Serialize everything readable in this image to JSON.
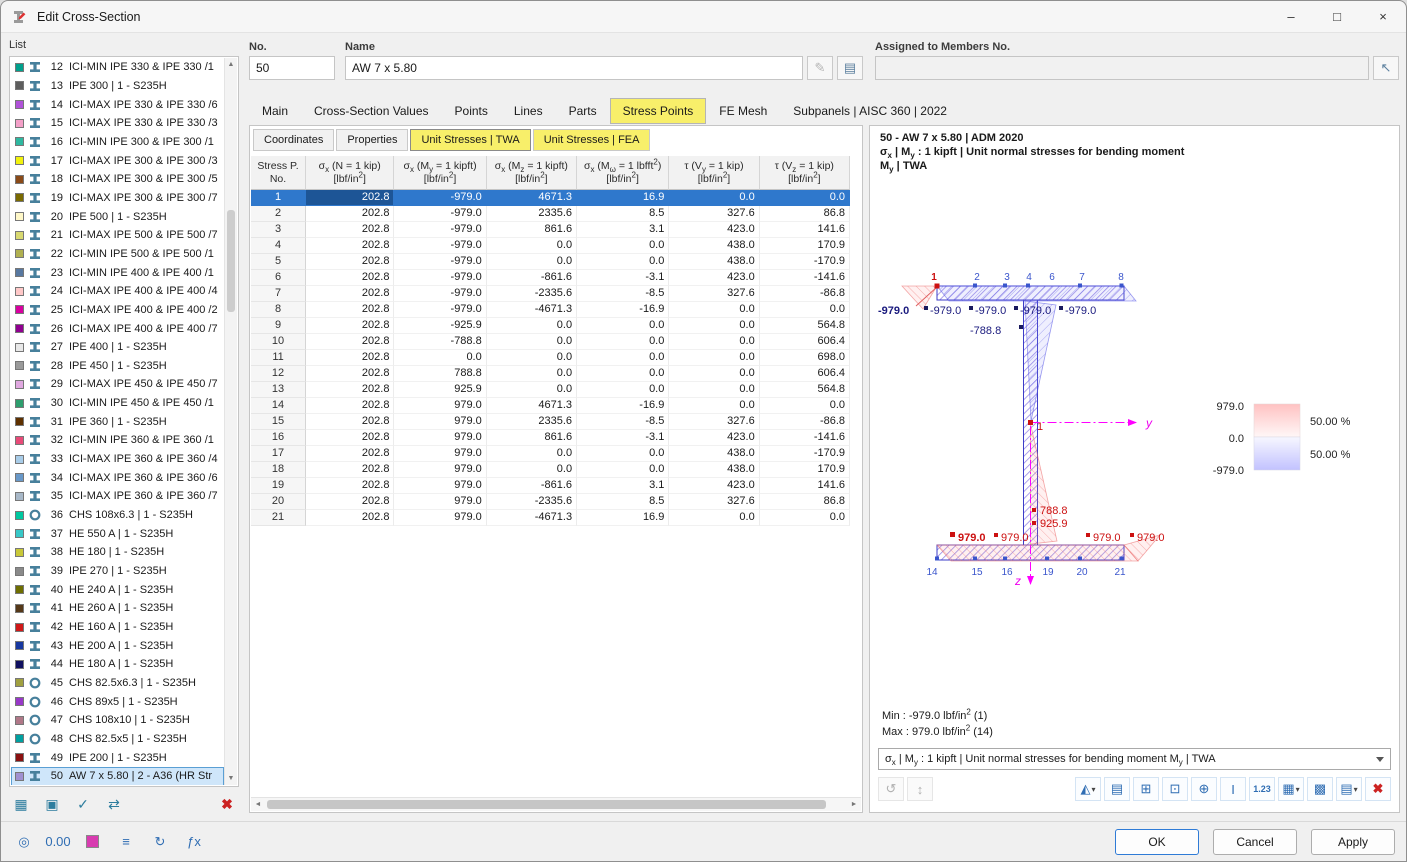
{
  "window": {
    "title": "Edit Cross-Section",
    "controls": {
      "minimize": "–",
      "maximize": "□",
      "close": "×"
    }
  },
  "colors": {
    "accent_blue": "#2f78cc",
    "highlight_yellow": "#f8ef6a",
    "list_selection": "#cfe6fa",
    "axis_magenta": "#ff00ff",
    "negative_navy": "#1a1a7e",
    "positive_red": "#cc1111",
    "swatch_magenta": "#d83cb0"
  },
  "left_panel": {
    "title": "List",
    "selected_no": "50",
    "items": [
      {
        "no": "12",
        "label": "ICI-MIN IPE 330 & IPE 330 /1",
        "color": "#00A08C",
        "icon": "ibeam"
      },
      {
        "no": "13",
        "label": "IPE 300 | 1 - S235H",
        "color": "#5E5E5E",
        "icon": "ibeam"
      },
      {
        "no": "14",
        "label": "ICI-MAX IPE 330 & IPE 330 /6",
        "color": "#B052D8",
        "icon": "ibeam"
      },
      {
        "no": "15",
        "label": "ICI-MAX IPE 330 & IPE 330 /3",
        "color": "#F4A0C8",
        "icon": "ibeam"
      },
      {
        "no": "16",
        "label": "ICI-MIN IPE 300 & IPE 300 /1",
        "color": "#2EB8A0",
        "icon": "ibeam"
      },
      {
        "no": "17",
        "label": "ICI-MAX IPE 300 & IPE 300 /3",
        "color": "#F2F20C",
        "icon": "ibeam"
      },
      {
        "no": "18",
        "label": "ICI-MAX IPE 300 & IPE 300 /5",
        "color": "#8A4A18",
        "icon": "ibeam"
      },
      {
        "no": "19",
        "label": "ICI-MAX IPE 300 & IPE 300 /7",
        "color": "#7A6A00",
        "icon": "ibeam"
      },
      {
        "no": "20",
        "label": "IPE 500 | 1 - S235H",
        "color": "#FFF8C8",
        "icon": "ibeam"
      },
      {
        "no": "21",
        "label": "ICI-MAX IPE 500 & IPE 500 /7",
        "color": "#D8D870",
        "icon": "ibeam"
      },
      {
        "no": "22",
        "label": "ICI-MIN IPE 500 & IPE 500 /1",
        "color": "#B0B050",
        "icon": "ibeam"
      },
      {
        "no": "23",
        "label": "ICI-MIN IPE 400 & IPE 400 /1",
        "color": "#5878A0",
        "icon": "ibeam"
      },
      {
        "no": "24",
        "label": "ICI-MAX IPE 400 & IPE 400 /4",
        "color": "#FFC8C8",
        "icon": "ibeam"
      },
      {
        "no": "25",
        "label": "ICI-MAX IPE 400 & IPE 400 /2",
        "color": "#D800A0",
        "icon": "ibeam"
      },
      {
        "no": "26",
        "label": "ICI-MAX IPE 400 & IPE 400 /7",
        "color": "#900090",
        "icon": "ibeam"
      },
      {
        "no": "27",
        "label": "IPE 400 | 1 - S235H",
        "color": "#E8E8E8",
        "icon": "ibeam"
      },
      {
        "no": "28",
        "label": "IPE 450 | 1 - S235H",
        "color": "#9A9A9A",
        "icon": "ibeam"
      },
      {
        "no": "29",
        "label": "ICI-MAX IPE 450 & IPE 450 /7",
        "color": "#E0A8E0",
        "icon": "ibeam"
      },
      {
        "no": "30",
        "label": "ICI-MIN IPE 450 & IPE 450 /1",
        "color": "#2E9E6E",
        "icon": "ibeam"
      },
      {
        "no": "31",
        "label": "IPE 360 | 1 - S235H",
        "color": "#5E3000",
        "icon": "ibeam"
      },
      {
        "no": "32",
        "label": "ICI-MIN IPE 360 & IPE 360 /1",
        "color": "#E84A78",
        "icon": "ibeam"
      },
      {
        "no": "33",
        "label": "ICI-MAX IPE 360 & IPE 360 /4",
        "color": "#A8CCE8",
        "icon": "ibeam"
      },
      {
        "no": "34",
        "label": "ICI-MAX IPE 360 & IPE 360 /6",
        "color": "#6898C8",
        "icon": "ibeam"
      },
      {
        "no": "35",
        "label": "ICI-MAX IPE 360 & IPE 360 /7",
        "color": "#A8B8C8",
        "icon": "ibeam"
      },
      {
        "no": "36",
        "label": "CHS 108x6.3 | 1 - S235H",
        "color": "#00C8A0",
        "icon": "chs"
      },
      {
        "no": "37",
        "label": "HE 550 A | 1 - S235H",
        "color": "#38C8C8",
        "icon": "ibeam"
      },
      {
        "no": "38",
        "label": "HE 180 | 1 - S235H",
        "color": "#C8C838",
        "icon": "ibeam"
      },
      {
        "no": "39",
        "label": "IPE 270 | 1 - S235H",
        "color": "#8A8A8A",
        "icon": "ibeam"
      },
      {
        "no": "40",
        "label": "HE 240 A | 1 - S235H",
        "color": "#6E6E00",
        "icon": "ibeam"
      },
      {
        "no": "41",
        "label": "HE 260 A | 1 - S235H",
        "color": "#553818",
        "icon": "ibeam"
      },
      {
        "no": "42",
        "label": "HE 160 A | 1 - S235H",
        "color": "#D01818",
        "icon": "ibeam"
      },
      {
        "no": "43",
        "label": "HE 200 A | 1 - S235H",
        "color": "#1838A0",
        "icon": "ibeam"
      },
      {
        "no": "44",
        "label": "HE 180 A | 1 - S235H",
        "color": "#101060",
        "icon": "ibeam"
      },
      {
        "no": "45",
        "label": "CHS 82.5x6.3 | 1 - S235H",
        "color": "#A0A040",
        "icon": "chs"
      },
      {
        "no": "46",
        "label": "CHS 89x5 | 1 - S235H",
        "color": "#9838C8",
        "icon": "chs"
      },
      {
        "no": "47",
        "label": "CHS 108x10 | 1 - S235H",
        "color": "#B07888",
        "icon": "chs"
      },
      {
        "no": "48",
        "label": "CHS 82.5x5 | 1 - S235H",
        "color": "#00A0A0",
        "icon": "chs"
      },
      {
        "no": "49",
        "label": "IPE 200 | 1 - S235H",
        "color": "#8A1010",
        "icon": "ibeam"
      },
      {
        "no": "50",
        "label": "AW 7 x 5.80 | 2 - A36 (HR Str",
        "color": "#A090D0",
        "icon": "ibeam"
      }
    ]
  },
  "fields": {
    "no_label": "No.",
    "no_value": "50",
    "name_label": "Name",
    "name_value": "AW 7 x 5.80",
    "assigned_label": "Assigned to Members No.",
    "assigned_value": ""
  },
  "tabs": {
    "items": [
      "Main",
      "Cross-Section Values",
      "Points",
      "Lines",
      "Parts",
      "Stress Points",
      "FE Mesh",
      "Subpanels | AISC 360 | 2022"
    ],
    "active": "Stress Points"
  },
  "subtabs": {
    "items": [
      {
        "label": "Coordinates",
        "highlight": false,
        "active": false
      },
      {
        "label": "Properties",
        "highlight": false,
        "active": false
      },
      {
        "label": "Unit Stresses | TWA",
        "highlight": true,
        "active": true
      },
      {
        "label": "Unit Stresses | FEA",
        "highlight": true,
        "active": false
      }
    ]
  },
  "table": {
    "headers": [
      {
        "l1": "Stress P.",
        "l2": "No."
      },
      {
        "l1": "σ~x~ (N = 1 kip)",
        "l2": "[lbf/in^2^]"
      },
      {
        "l1": "σ~x~ (M~y~ = 1 kipft)",
        "l2": "[lbf/in^2^]"
      },
      {
        "l1": "σ~x~ (M~z~ = 1 kipft)",
        "l2": "[lbf/in^2^]"
      },
      {
        "l1": "σ~x~ (M~ω~ = 1 lbfft^2^)",
        "l2": "[lbf/in^2^]"
      },
      {
        "l1": "τ (V~y~ = 1 kip)",
        "l2": "[lbf/in^2^]"
      },
      {
        "l1": "τ (V~z~ = 1 kip)",
        "l2": "[lbf/in^2^]"
      }
    ],
    "selected_row": "1",
    "rows": [
      {
        "no": "1",
        "values": [
          "202.8",
          "-979.0",
          "4671.3",
          "16.9",
          "0.0",
          "0.0"
        ]
      },
      {
        "no": "2",
        "values": [
          "202.8",
          "-979.0",
          "2335.6",
          "8.5",
          "327.6",
          "86.8"
        ]
      },
      {
        "no": "3",
        "values": [
          "202.8",
          "-979.0",
          "861.6",
          "3.1",
          "423.0",
          "141.6"
        ]
      },
      {
        "no": "4",
        "values": [
          "202.8",
          "-979.0",
          "0.0",
          "0.0",
          "438.0",
          "170.9"
        ]
      },
      {
        "no": "5",
        "values": [
          "202.8",
          "-979.0",
          "0.0",
          "0.0",
          "438.0",
          "-170.9"
        ]
      },
      {
        "no": "6",
        "values": [
          "202.8",
          "-979.0",
          "-861.6",
          "-3.1",
          "423.0",
          "-141.6"
        ]
      },
      {
        "no": "7",
        "values": [
          "202.8",
          "-979.0",
          "-2335.6",
          "-8.5",
          "327.6",
          "-86.8"
        ]
      },
      {
        "no": "8",
        "values": [
          "202.8",
          "-979.0",
          "-4671.3",
          "-16.9",
          "0.0",
          "0.0"
        ]
      },
      {
        "no": "9",
        "values": [
          "202.8",
          "-925.9",
          "0.0",
          "0.0",
          "0.0",
          "564.8"
        ]
      },
      {
        "no": "10",
        "values": [
          "202.8",
          "-788.8",
          "0.0",
          "0.0",
          "0.0",
          "606.4"
        ]
      },
      {
        "no": "11",
        "values": [
          "202.8",
          "0.0",
          "0.0",
          "0.0",
          "0.0",
          "698.0"
        ]
      },
      {
        "no": "12",
        "values": [
          "202.8",
          "788.8",
          "0.0",
          "0.0",
          "0.0",
          "606.4"
        ]
      },
      {
        "no": "13",
        "values": [
          "202.8",
          "925.9",
          "0.0",
          "0.0",
          "0.0",
          "564.8"
        ]
      },
      {
        "no": "14",
        "values": [
          "202.8",
          "979.0",
          "4671.3",
          "-16.9",
          "0.0",
          "0.0"
        ]
      },
      {
        "no": "15",
        "values": [
          "202.8",
          "979.0",
          "2335.6",
          "-8.5",
          "327.6",
          "-86.8"
        ]
      },
      {
        "no": "16",
        "values": [
          "202.8",
          "979.0",
          "861.6",
          "-3.1",
          "423.0",
          "-141.6"
        ]
      },
      {
        "no": "17",
        "values": [
          "202.8",
          "979.0",
          "0.0",
          "0.0",
          "438.0",
          "-170.9"
        ]
      },
      {
        "no": "18",
        "values": [
          "202.8",
          "979.0",
          "0.0",
          "0.0",
          "438.0",
          "170.9"
        ]
      },
      {
        "no": "19",
        "values": [
          "202.8",
          "979.0",
          "-861.6",
          "3.1",
          "423.0",
          "141.6"
        ]
      },
      {
        "no": "20",
        "values": [
          "202.8",
          "979.0",
          "-2335.6",
          "8.5",
          "327.6",
          "86.8"
        ]
      },
      {
        "no": "21",
        "values": [
          "202.8",
          "979.0",
          "-4671.3",
          "16.9",
          "0.0",
          "0.0"
        ]
      }
    ]
  },
  "graphics": {
    "header_line1": "50 - AW 7 x 5.80 | ADM 2020",
    "header_line2": "σ~x~ | M~y~ : 1 kipft | Unit normal stresses for bending moment M~y~ | TWA",
    "min_text": "Min : -979.0 lbf/in^2^ (1)",
    "max_text": "Max :  979.0 lbf/in^2^ (14)",
    "result_selector": "σ~x~ | M~y~ : 1 kipft | Unit normal stresses for bending moment M~y~ | TWA",
    "axis": {
      "y": "y",
      "z": "z"
    },
    "legend": {
      "max": "979.0",
      "zero": "0.0",
      "min": "-979.0",
      "pos_pct": "50.00 %",
      "neg_pct": "50.00 %"
    },
    "labels": {
      "top_bold": "-979.0",
      "top_row": [
        "-979.0",
        "-979.0",
        "-979.0",
        "-979.0"
      ],
      "web_upper": "-788.8",
      "web_lower": [
        "788.8",
        "925.9"
      ],
      "bottom_bold": "979.0",
      "bottom_row": [
        "979.0",
        "979.0",
        "979.0"
      ],
      "centroid": "1"
    },
    "points": {
      "top": [
        "1",
        "2",
        "3",
        "4",
        "6",
        "7",
        "8"
      ],
      "bottom": [
        "14",
        "15",
        "16",
        "19",
        "20",
        "21"
      ]
    }
  },
  "toolbars": {
    "list_actions": [
      {
        "name": "new-section-button",
        "glyph": "▦"
      },
      {
        "name": "copy-section-button",
        "glyph": "▣"
      },
      {
        "name": "check-section-button",
        "glyph": "✓"
      },
      {
        "name": "renumber-section-button",
        "glyph": "⇄"
      },
      {
        "name": "delete-section-button",
        "glyph": "✖",
        "del": true
      }
    ],
    "graphic_left": [
      {
        "name": "sync-view-button",
        "glyph": "↺",
        "disabled": true
      },
      {
        "name": "section-height-button",
        "glyph": "↕",
        "disabled": true
      }
    ],
    "graphic_right": [
      {
        "name": "result-type-button",
        "glyph": "◭",
        "dropdown": true
      },
      {
        "name": "print-graphic-button",
        "glyph": "▤"
      },
      {
        "name": "show-values-button",
        "glyph": "⊞"
      },
      {
        "name": "show-points-button",
        "glyph": "⊡"
      },
      {
        "name": "show-axes-button",
        "glyph": "⊕"
      },
      {
        "name": "show-section-button",
        "glyph": "I"
      },
      {
        "name": "decimal-places-button",
        "glyph": "1.23",
        "num": true
      },
      {
        "name": "table-view-button",
        "glyph": "▦",
        "dropdown": true
      },
      {
        "name": "grid-button",
        "glyph": "▩"
      },
      {
        "name": "print-button",
        "glyph": "▤",
        "dropdown": true
      },
      {
        "name": "reset-view-button",
        "glyph": "✖",
        "red": true
      }
    ],
    "footer_left": [
      {
        "name": "print-preview-button",
        "glyph": "◎"
      },
      {
        "name": "units-button",
        "glyph": "0.00",
        "num": true
      },
      {
        "name": "colors-button",
        "glyph": "",
        "swatch": "#d83cb0"
      },
      {
        "name": "display-list-button",
        "glyph": "≡"
      },
      {
        "name": "refresh-button",
        "glyph": "↻"
      },
      {
        "name": "formula-button",
        "glyph": "ƒx",
        "num": true
      }
    ]
  },
  "footer": {
    "ok": "OK",
    "cancel": "Cancel",
    "apply": "Apply"
  }
}
